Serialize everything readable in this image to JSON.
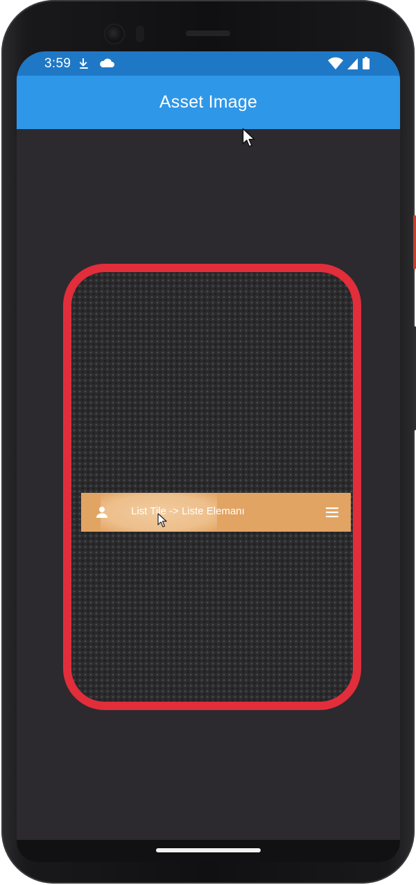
{
  "status_bar": {
    "time": "3:59",
    "left_icons": [
      "download-icon",
      "cloud-icon"
    ],
    "right_icons": [
      "wifi-icon",
      "signal-icon",
      "battery-icon"
    ],
    "color": "#1f78c6"
  },
  "app_bar": {
    "title": "Asset Image",
    "color": "#2e97e8"
  },
  "card": {
    "border_color": "#e22d3b",
    "list_tile": {
      "leading_icon": "person-icon",
      "title": "List Tile -> Liste Elemanı",
      "trailing_icon": "menu-icon",
      "color": "#e2a463"
    }
  },
  "colors": {
    "background": "#2c2a2e"
  }
}
